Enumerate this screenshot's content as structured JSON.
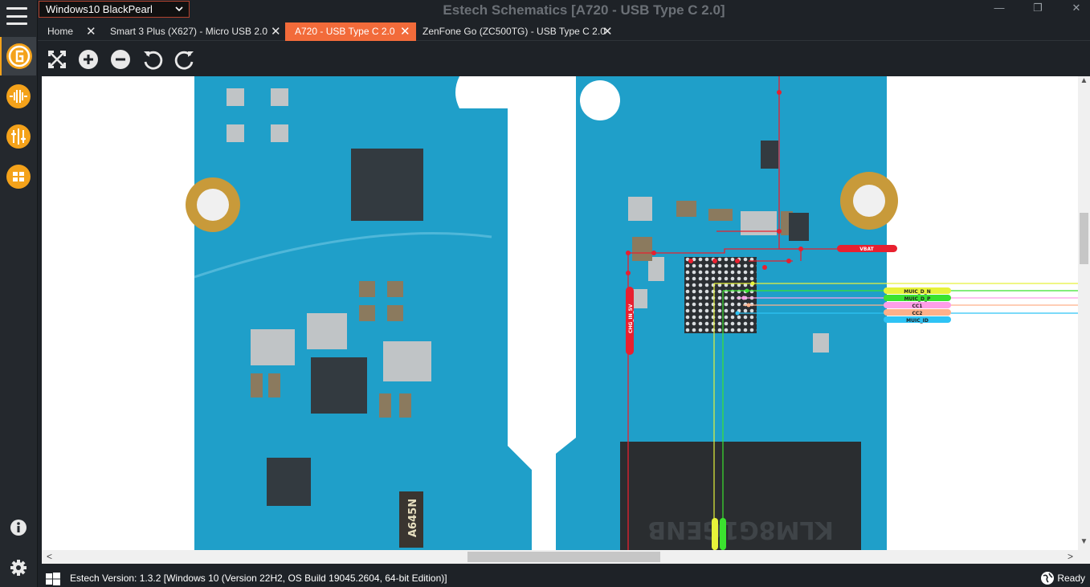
{
  "window": {
    "title": "Estech Schematics [A720 - USB Type C 2.0]",
    "minimize_glyph": "—",
    "restore_glyph": "❐",
    "close_glyph": "✕"
  },
  "skin_selector": {
    "value": "Windows10 BlackPearl"
  },
  "tabs": [
    {
      "label": "Home",
      "active": false
    },
    {
      "label": "Smart 3 Plus (X627) - Micro USB 2.0",
      "active": false
    },
    {
      "label": "A720 - USB Type C 2.0",
      "active": true
    },
    {
      "label": "ZenFone Go (ZC500TG) - USB Type C 2.0",
      "active": false
    }
  ],
  "tab_close_glyph": "✕",
  "toolbar": [
    "fit-screen-icon",
    "zoom-in-icon",
    "zoom-out-icon",
    "rotate-left-icon",
    "rotate-right-icon"
  ],
  "sidebar": [
    "menu-icon",
    "gsm-logo-icon",
    "signal-icon",
    "circuit-icon",
    "ic-chip-icon",
    "info-icon",
    "gear-icon"
  ],
  "board": {
    "chip_markings": [
      "A645N",
      "KLM8G1GENB"
    ],
    "net_labels": [
      {
        "name": "VBAT",
        "color": "#e8202f"
      },
      {
        "name": "MUIC_D_N",
        "color": "#e6f23a"
      },
      {
        "name": "MUIC_D_P",
        "color": "#3be22f"
      },
      {
        "name": "CC1",
        "color": "#ff9ee8"
      },
      {
        "name": "CC2",
        "color": "#ffb08a"
      },
      {
        "name": "MUIC_ID",
        "color": "#2ec3f5"
      },
      {
        "name": "CHG_IN_5V",
        "color": "#e8202f"
      }
    ]
  },
  "scroll": {
    "left_arrow": "<",
    "right_arrow": ">",
    "up_arrow": "▲",
    "down_arrow": "▼"
  },
  "status": {
    "version_text": "Estech Version: 1.3.2 [Windows 10 (Version 22H2, OS Build 19045.2604, 64-bit Edition)]",
    "state": "Ready"
  },
  "colors": {
    "accent": "#f26b3a",
    "pcb": "#1e9cc6",
    "background": "#1e2227"
  }
}
